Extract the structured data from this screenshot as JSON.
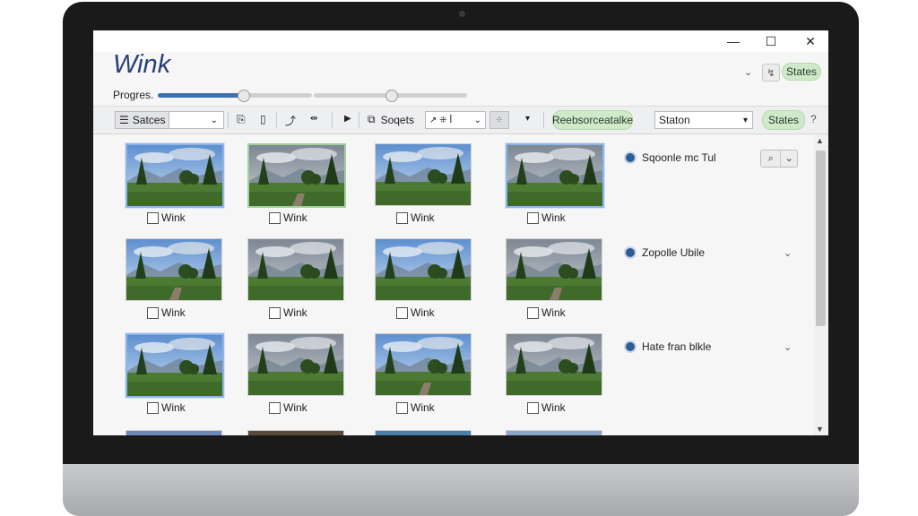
{
  "window": {
    "minimize": "—",
    "maximize": "☐",
    "close": "✕"
  },
  "app": {
    "title": "Wink"
  },
  "header": {
    "chevron": "⌄",
    "tool_icon": "↯",
    "states_badge": "States"
  },
  "progress": {
    "label": "Progres.",
    "slider1": 0.55,
    "slider2": 0.5
  },
  "toolbar": {
    "view_button": "Satces",
    "view_dropdown": "⌄",
    "sort_label": "Soqets",
    "filter_value": "↗ ⁜ ꟾ",
    "resource_pill": "Reebsorceatalke",
    "status_select": "Staton",
    "states_pill": "States",
    "help": "?"
  },
  "thumbnails": [
    {
      "caption": "Wink",
      "selected": "blue"
    },
    {
      "caption": "Wink",
      "selected": "green"
    },
    {
      "caption": "Wink",
      "selected": "none"
    },
    {
      "caption": "Wink",
      "selected": "blue"
    },
    {
      "caption": "Wink",
      "selected": "none"
    },
    {
      "caption": "Wink",
      "selected": "none"
    },
    {
      "caption": "Wink",
      "selected": "none"
    },
    {
      "caption": "Wink",
      "selected": "none"
    },
    {
      "caption": "Wink",
      "selected": "blue"
    },
    {
      "caption": "Wink",
      "selected": "none"
    },
    {
      "caption": "Wink",
      "selected": "none"
    },
    {
      "caption": "Wink",
      "selected": "none"
    }
  ],
  "groups": [
    {
      "label": "Sqoonle mc Tul"
    },
    {
      "label": "Zopolle Ubile"
    },
    {
      "label": "Hate fran blkle"
    }
  ],
  "colors": {
    "accent": "#3d6fb3",
    "pill_green": "#cfe9c9",
    "title_blue": "#27407a"
  }
}
